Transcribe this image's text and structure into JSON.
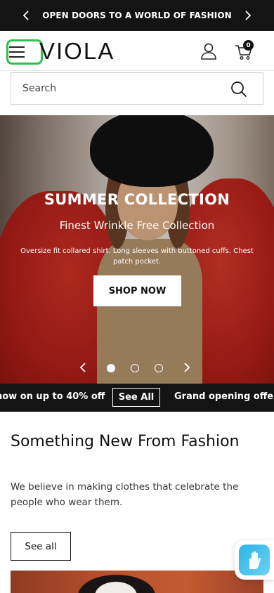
{
  "announcement": {
    "text": "OPEN DOORS TO A WORLD OF FASHION"
  },
  "header": {
    "logo": "VIOLA",
    "cart_count": "0"
  },
  "search": {
    "placeholder": "Search"
  },
  "hero": {
    "title": "SUMMER COLLECTION",
    "subtitle": "Finest Wrinkle Free Collection",
    "description": "Oversize fit collared shirt. Long sleeves with buttoned cuffs. Chest patch pocket.",
    "button": "SHOP NOW",
    "slides": 3,
    "active_slide": 1
  },
  "marquee": {
    "text_left": "now on up to 40% off",
    "link": "See All",
    "text_right": "Grand opening offe"
  },
  "section": {
    "title": "Something New From Fashion",
    "description": "We believe in making clothes that celebrate the people who wear them.",
    "button": "See all"
  },
  "colors": {
    "focus_ring": "#2fbf4d",
    "dark_bar": "#141414",
    "chat_widget": "#2bb3e8"
  }
}
